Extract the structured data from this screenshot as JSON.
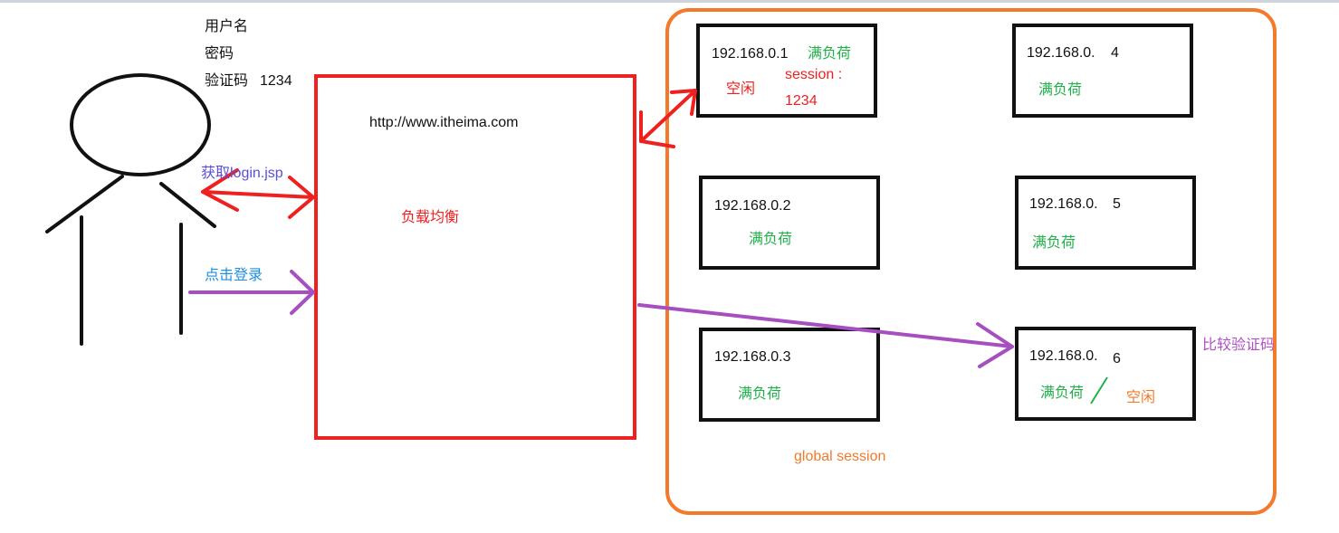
{
  "user": {
    "username_label": "用户名",
    "password_label": "密码",
    "captcha_label": "验证码",
    "captcha_value": "1234"
  },
  "load_balancer": {
    "url": "http://www.itheima.com",
    "label": "负载均衡"
  },
  "arrows": {
    "get_login": "获取login.jsp",
    "click_login": "点击登录",
    "compare_captcha": "比较验证码"
  },
  "global_session_label": "global session",
  "servers": [
    {
      "ip": "192.168.0.1",
      "full": "满负荷",
      "idle": "空闲",
      "session": "session :",
      "session_value": "1234"
    },
    {
      "ip": "192.168.0.2",
      "full": "满负荷"
    },
    {
      "ip": "192.168.0.3",
      "full": "满负荷"
    },
    {
      "ip": "192.168.0.",
      "suffix": "4",
      "full": "满负荷"
    },
    {
      "ip": "192.168.0.",
      "suffix": "5",
      "full": "满负荷"
    },
    {
      "ip": "192.168.0.",
      "suffix": "6",
      "full": "满负荷",
      "idle": "空闲"
    }
  ],
  "colors": {
    "red": "#ee2020",
    "green": "#21b04a",
    "orange": "#f4792a",
    "purple": "#a64fc0",
    "blue": "#5a4fd8",
    "cyan": "#1c8fe0"
  }
}
